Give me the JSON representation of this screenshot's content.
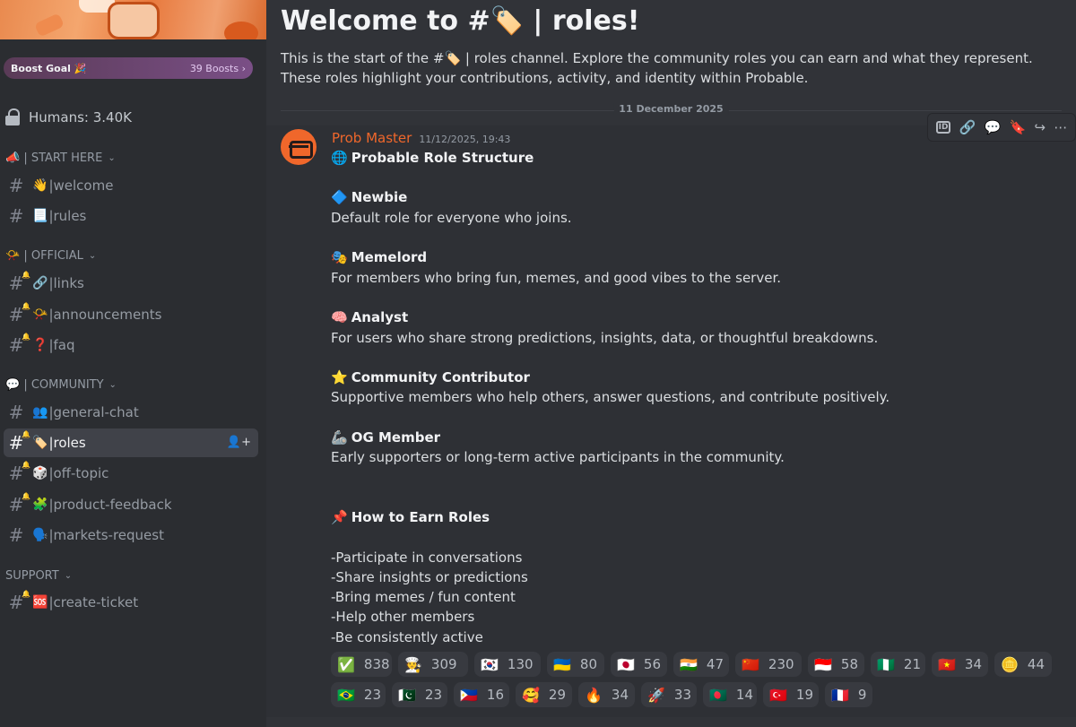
{
  "sidebar": {
    "boost": {
      "label": "Boost Goal 🎉",
      "count": "39 Boosts",
      "chevron": "›"
    },
    "members": "Humans: 3.40K",
    "categories": [
      {
        "label": "📣 | START HERE"
      },
      {
        "label": "📯 | OFFICIAL"
      },
      {
        "label": "💬 | COMMUNITY"
      },
      {
        "label": "SUPPORT"
      }
    ],
    "channels": [
      {
        "emoji": "👋",
        "label": "|welcome"
      },
      {
        "emoji": "📃",
        "label": "|rules"
      },
      {
        "emoji": "🔗",
        "label": "|links"
      },
      {
        "emoji": "📯",
        "label": "|announcements"
      },
      {
        "emoji": "❓",
        "label": "|faq"
      },
      {
        "emoji": "👥",
        "label": "|general-chat"
      },
      {
        "emoji": "🏷️",
        "label": "|roles"
      },
      {
        "emoji": "🎲",
        "label": "|off-topic"
      },
      {
        "emoji": "🧩",
        "label": "|product-feedback"
      },
      {
        "emoji": "🗣️",
        "label": "|markets-request"
      },
      {
        "emoji": "🆘",
        "label": "|create-ticket"
      }
    ]
  },
  "main": {
    "welcome_title": "Welcome to #🏷️ | roles!",
    "intro": "This is the start of the #🏷️ | roles channel. Explore the community roles you can earn and what they represent. These roles highlight your contributions, activity, and identity within Probable.",
    "date_divider": "11 December 2025",
    "message": {
      "author": "Prob Master",
      "timestamp": "11/12/2025, 19:43",
      "heading_emoji": "🌐",
      "heading": "Probable Role Structure",
      "roles": [
        {
          "emoji": "🔷",
          "name": "Newbie",
          "desc": "Default role for everyone who joins."
        },
        {
          "emoji": "🎭",
          "name": "Memelord",
          "desc": "For members who bring fun, memes, and good vibes to the server."
        },
        {
          "emoji": "🧠",
          "name": "Analyst",
          "desc": "For users who share strong predictions, insights, data, or thoughtful breakdowns."
        },
        {
          "emoji": "⭐",
          "name": "Community Contributor",
          "desc": "Supportive members who help others, answer questions, and contribute positively."
        },
        {
          "emoji": "🦾",
          "name": "OG Member",
          "desc": "Early supporters or long-term active participants in the community."
        }
      ],
      "earn_emoji": "📌",
      "earn_heading": "How to Earn Roles",
      "earn_items": [
        "-Participate in conversations",
        "-Share insights or predictions",
        "-Bring memes / fun content",
        "-Help other members",
        "-Be consistently active"
      ]
    },
    "reactions_row1": [
      {
        "emoji": "✅",
        "count": "838"
      },
      {
        "emoji": "🧑‍🍳",
        "count": "309"
      },
      {
        "emoji": "🇰🇷",
        "count": "130"
      },
      {
        "emoji": "🇺🇦",
        "count": "80"
      },
      {
        "emoji": "🇯🇵",
        "count": "56"
      },
      {
        "emoji": "🇮🇳",
        "count": "47"
      },
      {
        "emoji": "🇨🇳",
        "count": "230"
      },
      {
        "emoji": "🇮🇩",
        "count": "58"
      },
      {
        "emoji": "🇳🇬",
        "count": "21"
      },
      {
        "emoji": "🇻🇳",
        "count": "34"
      },
      {
        "emoji": "🪙",
        "count": "44"
      }
    ],
    "reactions_row2": [
      {
        "emoji": "🇧🇷",
        "count": "23"
      },
      {
        "emoji": "🇵🇰",
        "count": "23"
      },
      {
        "emoji": "🇵🇭",
        "count": "16"
      },
      {
        "emoji": "🥰",
        "count": "29"
      },
      {
        "emoji": "🔥",
        "count": "34"
      },
      {
        "emoji": "🚀",
        "count": "33"
      },
      {
        "emoji": "🇧🇩",
        "count": "14"
      },
      {
        "emoji": "🇹🇷",
        "count": "19"
      },
      {
        "emoji": "🇫🇷",
        "count": "9"
      }
    ],
    "toolbar": {
      "id_label": "ID",
      "link": "🔗",
      "thread": "💬",
      "bookmark": "🔖",
      "forward": "↪",
      "more": "⋯"
    }
  }
}
